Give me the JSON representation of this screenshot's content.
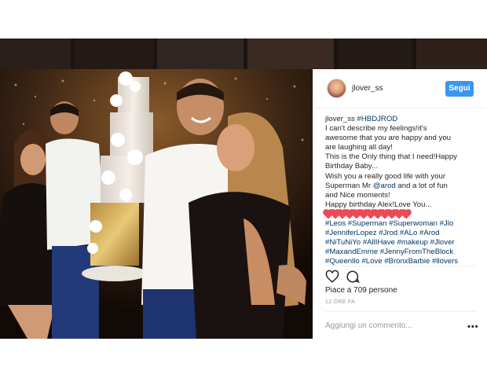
{
  "post": {
    "username": "jlover_ss",
    "follow_label": "Segui",
    "caption_lines": [
      {
        "user": "jlover_ss",
        "tag": "#HBDJROD"
      },
      "I can't describe my feelings!it's",
      "awesome that you are happy and you",
      "are laughing all day!",
      "This is the Only thing that I need!Happy",
      "Birthday Baby...",
      "Wish you a really good life with your",
      {
        "before": "Superman Mr ",
        "tag": "@arod",
        "after": " and a lot of fun"
      },
      "and Nice moments!",
      "Happy birthday Alex!Love You..."
    ],
    "hearts_count": 12,
    "hashtag_lines": [
      "#Leos #Superman #Superwoman #Jlo",
      "#JenniferLopez #Jrod #ALo #Arod",
      "#NiTuNiYo #AllIHave #makeup #Jlover",
      "#MaxandEmme #JennyFromTheBlock",
      "#Queenllo #Love  #BronxBarbie #llovers"
    ],
    "likes": "Piace a 709 persone",
    "time": "12 ORE FA",
    "comment_placeholder": "Aggiungi un commento...",
    "more_label": "•••"
  },
  "icons": {
    "like": "heart-outline-icon",
    "comment": "speech-bubble-icon",
    "more": "ellipsis-icon"
  },
  "colors": {
    "follow_button": "#3897f0",
    "hashtag": "#003569",
    "heart_emoji": "#ed4956"
  }
}
